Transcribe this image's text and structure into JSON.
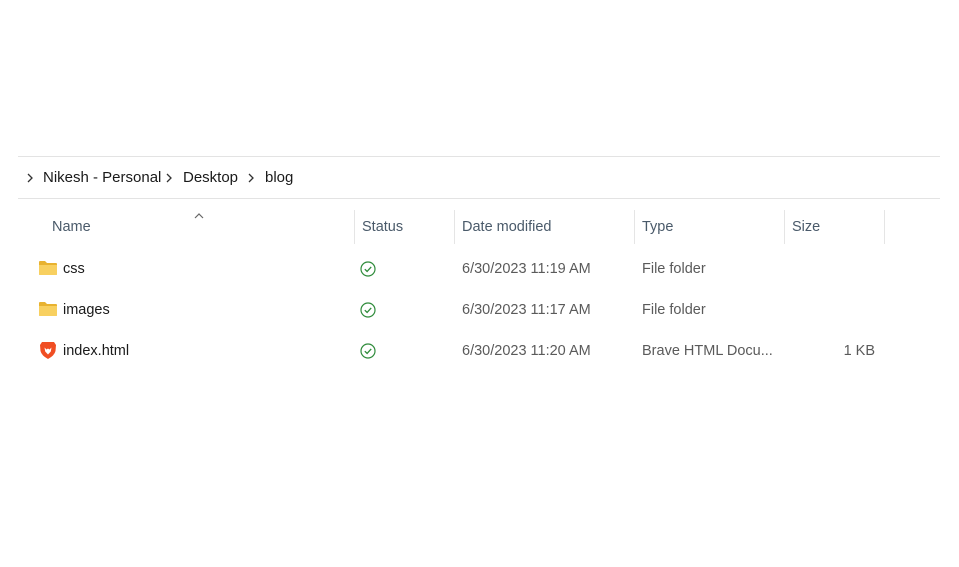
{
  "breadcrumb": {
    "items": [
      "Nikesh - Personal",
      "Desktop",
      "blog"
    ]
  },
  "columns": {
    "name": "Name",
    "status": "Status",
    "date_modified": "Date modified",
    "type": "Type",
    "size": "Size",
    "sort_column": "Name",
    "sort_direction": "ascending"
  },
  "files": [
    {
      "name": "css",
      "icon": "folder-icon",
      "status": "synced",
      "date_modified": "6/30/2023 11:19 AM",
      "type": "File folder",
      "size": ""
    },
    {
      "name": "images",
      "icon": "folder-icon",
      "status": "synced",
      "date_modified": "6/30/2023 11:17 AM",
      "type": "File folder",
      "size": ""
    },
    {
      "name": "index.html",
      "icon": "brave-html-file-icon",
      "status": "synced",
      "date_modified": "6/30/2023 11:20 AM",
      "type": "Brave HTML Docu...",
      "size": "1 KB"
    }
  ],
  "colors": {
    "synced_status": "#2e8b3a",
    "folder": "#f5c542",
    "brave": "#f04e23"
  }
}
